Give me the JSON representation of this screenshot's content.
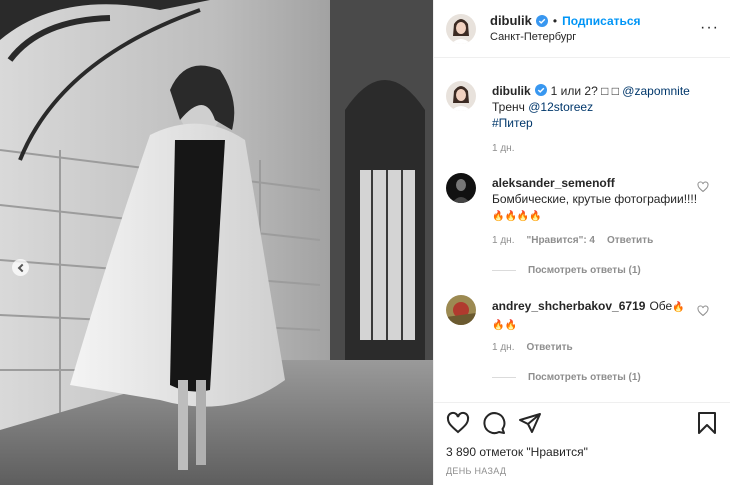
{
  "post": {
    "author": {
      "username": "dibulik",
      "follow_label": "Подписаться",
      "dot": "•",
      "location": "Санкт-Петербург"
    },
    "caption": {
      "username": "dibulik",
      "text_1": "1 или 2? ",
      "emoji": "□ □",
      "mention_1": "@zapomnite",
      "text_2": "Тренч ",
      "mention_2": "@12storeez",
      "hashtag": "#Питер",
      "time": "1 дн."
    },
    "comments": [
      {
        "username": "aleksander_semenoff",
        "text": "Бомбические, крутые фотографии!!!!",
        "emoji": "🔥🔥🔥🔥",
        "time": "1 дн.",
        "likes": "\"Нравится\": 4",
        "reply": "Ответить",
        "view_replies": "Посмотреть ответы (1)"
      },
      {
        "username": "andrey_shcherbakov_6719",
        "text": "Обе",
        "emoji_1": "🔥",
        "emoji_2": "🔥🔥",
        "time": "1 дн.",
        "reply": "Ответить",
        "view_replies": "Посмотреть ответы (1)"
      }
    ],
    "likes_count": "3 890 отметок \"Нравится\"",
    "date": "ДЕНЬ НАЗАД"
  },
  "icons": {
    "verified": "verified-badge-icon",
    "more": "more-options-icon",
    "like": "heart-icon",
    "comment": "comment-icon",
    "share": "paper-plane-icon",
    "save": "bookmark-icon",
    "carousel_prev": "chevron-left-icon"
  },
  "colors": {
    "follow": "#0095f6",
    "link": "#00376b",
    "secondary": "#8e8e8e",
    "verified": "#3897f0"
  }
}
